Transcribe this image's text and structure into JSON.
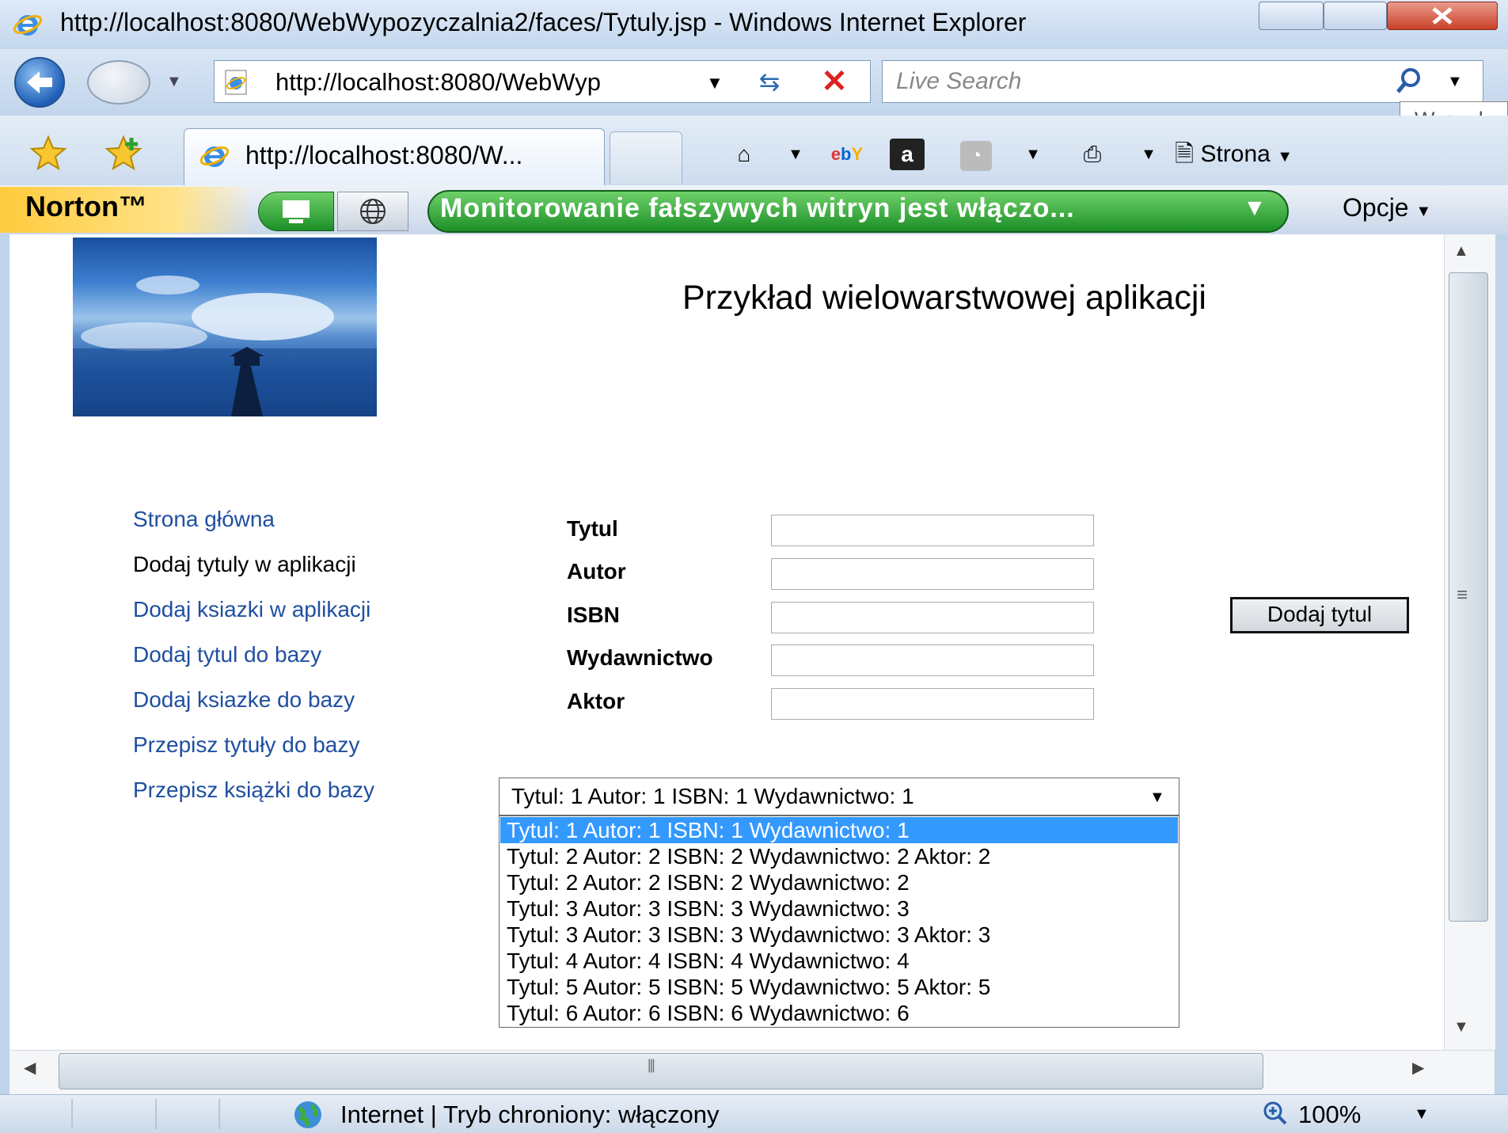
{
  "window": {
    "title": "http://localhost:8080/WebWypozyczalnia2/faces/Tytuly.jsp - Windows Internet Explorer"
  },
  "navbar": {
    "address": "http://localhost:8080/WebWyp",
    "search_placeholder": "Live Search",
    "search_tooltip": "Wyszuk"
  },
  "tabs": {
    "active_label": "http://localhost:8080/W..."
  },
  "toolbar": {
    "page_label": "Strona"
  },
  "norton": {
    "logo": "Norton™",
    "monitor_text": "Monitorowanie fałszywych witryn jest włączo...",
    "options_label": "Opcje"
  },
  "page": {
    "title": "Przykład wielowarstwowej aplikacji",
    "nav_links": [
      "Strona główna",
      "Dodaj tytuly w aplikacji",
      "Dodaj ksiazki w aplikacji",
      "Dodaj tytul do bazy",
      "Dodaj ksiazke do bazy",
      "Przepisz tytuły do bazy",
      "Przepisz książki do bazy"
    ],
    "form_labels": [
      "Tytul",
      "Autor",
      "ISBN",
      "Wydawnictwo",
      "Aktor"
    ],
    "form_values": [
      "",
      "",
      "",
      "",
      ""
    ],
    "add_button": "Dodaj tytul",
    "select_value": "Tytul: 1 Autor: 1 ISBN: 1 Wydawnictwo: 1",
    "select_options": [
      "Tytul: 1 Autor: 1 ISBN: 1 Wydawnictwo: 1",
      "Tytul: 2 Autor: 2 ISBN: 2 Wydawnictwo: 2 Aktor: 2",
      "Tytul: 2 Autor: 2 ISBN: 2 Wydawnictwo: 2",
      "Tytul: 3 Autor: 3 ISBN: 3 Wydawnictwo: 3",
      "Tytul: 3 Autor: 3 ISBN: 3 Wydawnictwo: 3 Aktor: 3",
      "Tytul: 4 Autor: 4 ISBN: 4 Wydawnictwo: 4",
      "Tytul: 5 Autor: 5 ISBN: 5 Wydawnictwo: 5 Aktor: 5",
      "Tytul: 6 Autor: 6 ISBN: 6 Wydawnictwo: 6"
    ],
    "selected_index": 0
  },
  "statusbar": {
    "zone": "Internet | Tryb chroniony: włączony",
    "zoom": "100%"
  },
  "colors": {
    "link": "#1f4fa0",
    "selection": "#3399ff",
    "norton_green": "#1c8f27"
  }
}
